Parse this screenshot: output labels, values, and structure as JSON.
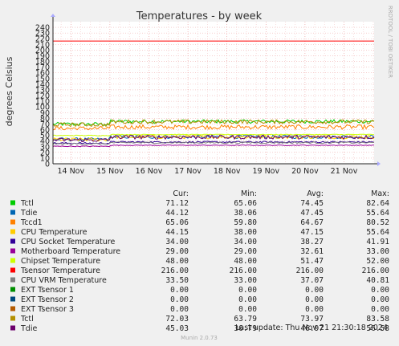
{
  "chart_data": {
    "type": "line",
    "title": "Temperatures - by week",
    "ylabel": "degrees Celsius",
    "ylim": [
      0,
      250
    ],
    "yticks": [
      0,
      10,
      20,
      30,
      40,
      50,
      60,
      70,
      80,
      90,
      100,
      110,
      120,
      130,
      140,
      150,
      160,
      170,
      180,
      190,
      200,
      210,
      220,
      230,
      240
    ],
    "xticks": [
      "14 Nov",
      "15 Nov",
      "16 Nov",
      "17 Nov",
      "18 Nov",
      "19 Nov",
      "20 Nov",
      "21 Nov"
    ],
    "grid": true,
    "side_text": "RRDTOOL / TOBI OETIKER",
    "columns": [
      "Cur:",
      "Min:",
      "Avg:",
      "Max:"
    ],
    "series": [
      {
        "name": "Tctl",
        "color": "#00cc00",
        "values": [
          71.12,
          65.06,
          74.45,
          82.64
        ],
        "display": [
          "71.12",
          "65.06",
          "74.45",
          "82.64"
        ]
      },
      {
        "name": "Tdie",
        "color": "#0066b3",
        "values": [
          44.12,
          38.06,
          47.45,
          55.64
        ],
        "display": [
          "44.12",
          "38.06",
          "47.45",
          "55.64"
        ]
      },
      {
        "name": "Tccd1",
        "color": "#ff8000",
        "values": [
          65.06,
          59.8,
          64.67,
          80.52
        ],
        "display": [
          "65.06",
          "59.80",
          "64.67",
          "80.52"
        ]
      },
      {
        "name": "CPU Temperature",
        "color": "#ffcc00",
        "values": [
          44.15,
          38.0,
          47.15,
          55.64
        ],
        "display": [
          "44.15",
          "38.00",
          "47.15",
          "55.64"
        ]
      },
      {
        "name": "CPU Socket Temperature",
        "color": "#330099",
        "values": [
          34.0,
          34.0,
          38.27,
          41.91
        ],
        "display": [
          "34.00",
          "34.00",
          "38.27",
          "41.91"
        ]
      },
      {
        "name": "Motherboard Temperature",
        "color": "#990099",
        "values": [
          29.0,
          29.0,
          32.61,
          33.0
        ],
        "display": [
          "29.00",
          "29.00",
          "32.61",
          "33.00"
        ]
      },
      {
        "name": "Chipset Temperature",
        "color": "#ccff00",
        "values": [
          48.0,
          48.0,
          51.47,
          52.0
        ],
        "display": [
          "48.00",
          "48.00",
          "51.47",
          "52.00"
        ]
      },
      {
        "name": "Tsensor Temperature",
        "color": "#ff0000",
        "values": [
          216.0,
          216.0,
          216.0,
          216.0
        ],
        "display": [
          "216.00",
          "216.00",
          "216.00",
          "216.00"
        ]
      },
      {
        "name": "CPU VRM Temperature",
        "color": "#808080",
        "values": [
          33.5,
          33.0,
          37.07,
          40.81
        ],
        "display": [
          "33.50",
          "33.00",
          "37.07",
          "40.81"
        ]
      },
      {
        "name": "EXT Tsensor 1",
        "color": "#008f00",
        "values": [
          0,
          0,
          0,
          0
        ],
        "display": [
          "0.00",
          "0.00",
          "0.00",
          "0.00"
        ]
      },
      {
        "name": "EXT Tsensor 2",
        "color": "#00487d",
        "values": [
          0,
          0,
          0,
          0
        ],
        "display": [
          "0.00",
          "0.00",
          "0.00",
          "0.00"
        ]
      },
      {
        "name": "EXT Tsensor 3",
        "color": "#b35a00",
        "values": [
          0,
          0,
          0,
          0
        ],
        "display": [
          "0.00",
          "0.00",
          "0.00",
          "0.00"
        ]
      },
      {
        "name": "Tctl",
        "color": "#b38f00",
        "values": [
          72.03,
          63.79,
          73.97,
          83.58
        ],
        "display": [
          "72.03",
          "63.79",
          "73.97",
          "83.58"
        ]
      },
      {
        "name": "Tdie",
        "color": "#6b006b",
        "values": [
          45.03,
          36.79,
          46.97,
          56.58
        ],
        "display": [
          "45.03",
          "36.79",
          "46.97",
          "56.58"
        ]
      }
    ],
    "last_update": "Last update: Thu Nov 21 21:30:18 2024",
    "footer": "Munin 2.0.73"
  }
}
